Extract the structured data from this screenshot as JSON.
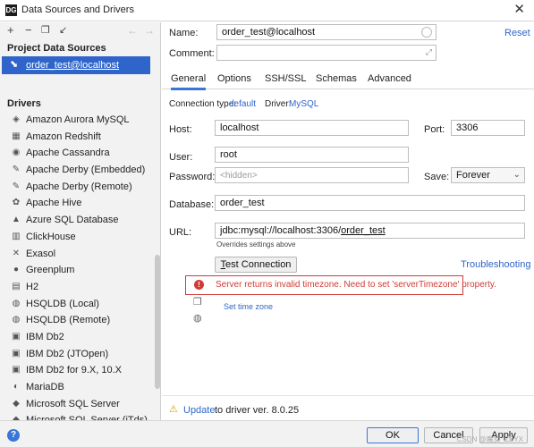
{
  "window": {
    "title": "Data Sources and Drivers",
    "app_icon_text": "DG"
  },
  "sidebar": {
    "toolbar_icons": [
      "add-icon",
      "remove-icon",
      "duplicate-icon",
      "move-to-group-icon",
      "back-icon",
      "forward-icon"
    ],
    "toolbar_glyphs": [
      "+",
      "−",
      "❐",
      "↙",
      "←",
      "→"
    ],
    "project_section": "Project Data Sources",
    "project_item": "order_test@localhost",
    "drivers_section": "Drivers",
    "drivers": [
      {
        "label": "Amazon Aurora MySQL",
        "icon": "aurora-icon",
        "glyph": "◈"
      },
      {
        "label": "Amazon Redshift",
        "icon": "redshift-icon",
        "glyph": "▦"
      },
      {
        "label": "Apache Cassandra",
        "icon": "cassandra-icon",
        "glyph": "◉"
      },
      {
        "label": "Apache Derby (Embedded)",
        "icon": "derby-icon",
        "glyph": "✎"
      },
      {
        "label": "Apache Derby (Remote)",
        "icon": "derby-icon",
        "glyph": "✎"
      },
      {
        "label": "Apache Hive",
        "icon": "hive-icon",
        "glyph": "✿"
      },
      {
        "label": "Azure SQL Database",
        "icon": "azure-icon",
        "glyph": "▲"
      },
      {
        "label": "ClickHouse",
        "icon": "clickhouse-icon",
        "glyph": "▥"
      },
      {
        "label": "Exasol",
        "icon": "exasol-icon",
        "glyph": "✕"
      },
      {
        "label": "Greenplum",
        "icon": "greenplum-icon",
        "glyph": "●"
      },
      {
        "label": "H2",
        "icon": "h2-icon",
        "glyph": "▤"
      },
      {
        "label": "HSQLDB (Local)",
        "icon": "hsqldb-icon",
        "glyph": "◍"
      },
      {
        "label": "HSQLDB (Remote)",
        "icon": "hsqldb-icon",
        "glyph": "◍"
      },
      {
        "label": "IBM Db2",
        "icon": "ibm-icon",
        "glyph": "▣"
      },
      {
        "label": "IBM Db2 (JTOpen)",
        "icon": "ibm-icon",
        "glyph": "▣"
      },
      {
        "label": "IBM Db2 for 9.X, 10.X",
        "icon": "ibm-icon",
        "glyph": "▣"
      },
      {
        "label": "MariaDB",
        "icon": "mariadb-icon",
        "glyph": "◐"
      },
      {
        "label": "Microsoft SQL Server",
        "icon": "mssql-icon",
        "glyph": "◆"
      },
      {
        "label": "Microsoft SQL Server (jTds)",
        "icon": "mssql-icon",
        "glyph": "◆"
      }
    ]
  },
  "form": {
    "name_label": "Name:",
    "name_value": "order_test@localhost",
    "reset_link": "Reset",
    "comment_label": "Comment:",
    "comment_value": ""
  },
  "tabs": [
    "General",
    "Options",
    "SSH/SSL",
    "Schemas",
    "Advanced"
  ],
  "general": {
    "conn_type_label": "Connection type:",
    "conn_type_value": "default",
    "driver_label": "Driver:",
    "driver_value": "MySQL",
    "host_label": "Host:",
    "host_value": "localhost",
    "port_label": "Port:",
    "port_value": "3306",
    "user_label": "User:",
    "user_value": "root",
    "password_label": "Password:",
    "password_placeholder": "<hidden>",
    "save_label": "Save:",
    "save_value": "Forever",
    "database_label": "Database:",
    "database_value": "order_test",
    "url_label": "URL:",
    "url_prefix": "jdbc:mysql://localhost:3306/",
    "url_db": "order_test",
    "url_note": "Overrides settings above",
    "test_button": "Test Connection",
    "test_mnemonic": "T",
    "test_rest": "est Connection",
    "troubleshooting_link": "Troubleshooting",
    "error_text": "Server returns invalid timezone. Need to set 'serverTimezone' property.",
    "set_timezone_link": "Set time zone"
  },
  "footer": {
    "update_link": "Update",
    "update_text": "to driver ver. 8.0.25",
    "ok": "OK",
    "cancel": "Cancel",
    "apply": "Apply",
    "watermark": "CSDN @魔女_ZBYX"
  },
  "colors": {
    "accent": "#2f65ca",
    "error": "#d23b35",
    "selection": "#2f65ca"
  }
}
